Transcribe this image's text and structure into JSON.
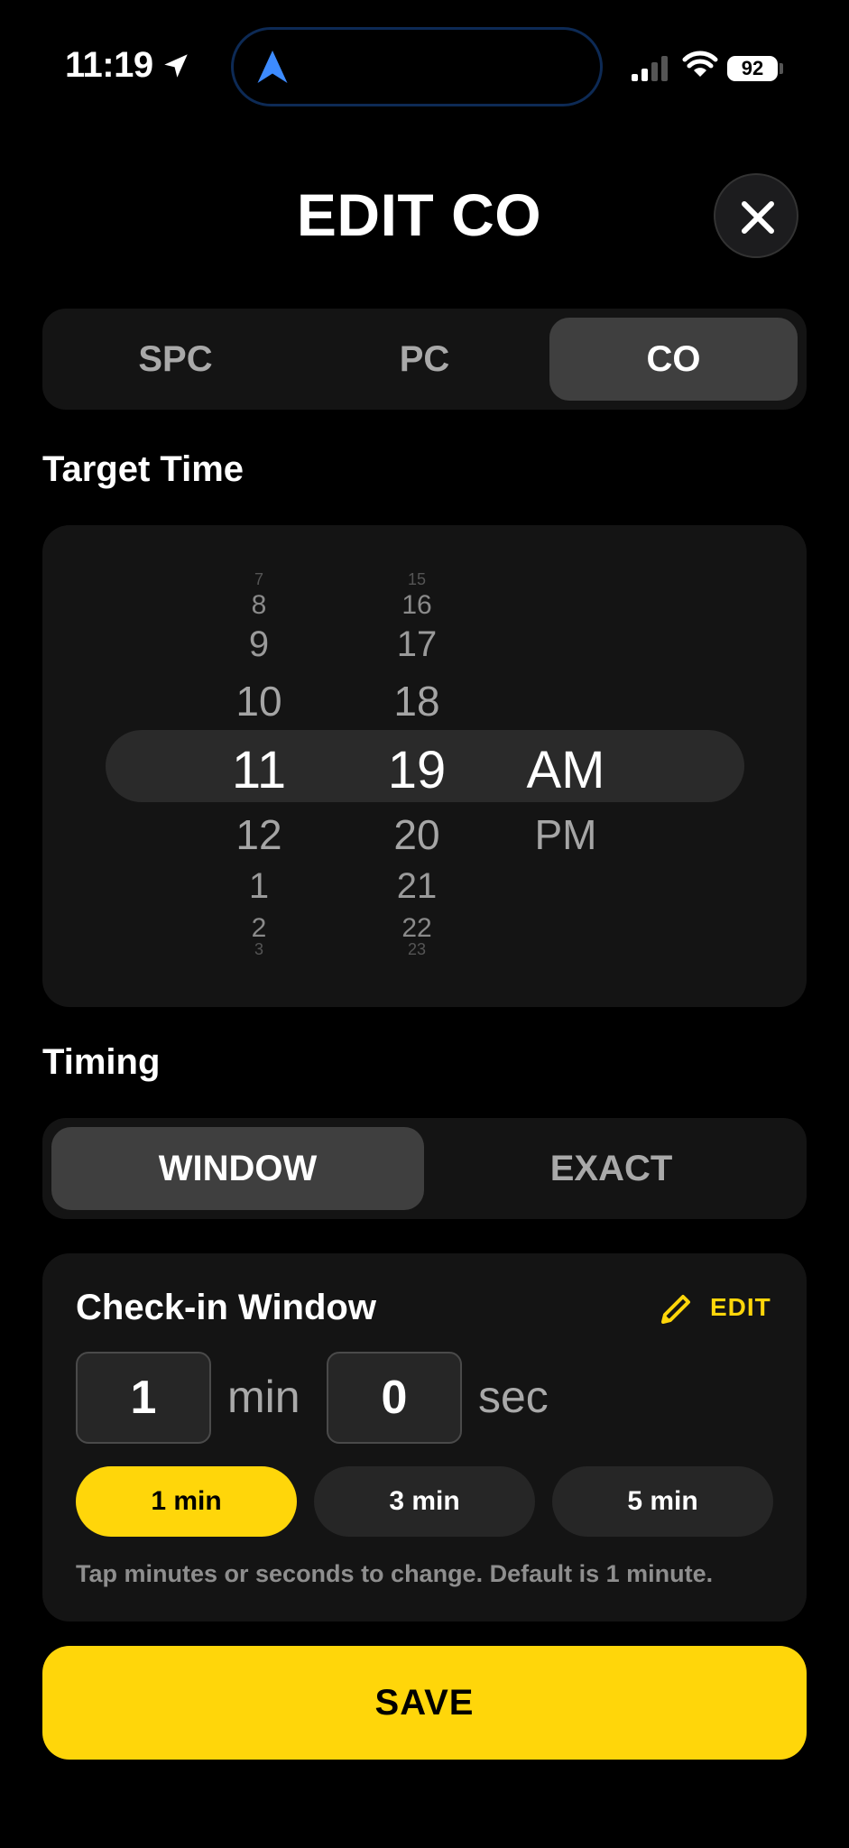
{
  "status_bar": {
    "time": "11:19",
    "battery": "92"
  },
  "header": {
    "title": "EDIT CO"
  },
  "mode_tabs": [
    {
      "label": "SPC",
      "active": false
    },
    {
      "label": "PC",
      "active": false
    },
    {
      "label": "CO",
      "active": true
    }
  ],
  "target_time": {
    "label": "Target Time",
    "hours": [
      "7",
      "8",
      "9",
      "10",
      "11",
      "12",
      "1",
      "2",
      "3"
    ],
    "minutes": [
      "15",
      "16",
      "17",
      "18",
      "19",
      "20",
      "21",
      "22",
      "23"
    ],
    "periods": [
      "AM",
      "PM"
    ],
    "selected": {
      "hour": "11",
      "minute": "19",
      "period": "AM"
    }
  },
  "timing": {
    "label": "Timing",
    "options": [
      {
        "label": "WINDOW",
        "active": true
      },
      {
        "label": "EXACT",
        "active": false
      }
    ]
  },
  "checkin": {
    "title": "Check-in Window",
    "edit_label": "EDIT",
    "minutes_value": "1",
    "minutes_unit": "min",
    "seconds_value": "0",
    "seconds_unit": "sec",
    "presets": [
      {
        "label": "1 min",
        "active": true
      },
      {
        "label": "3 min",
        "active": false
      },
      {
        "label": "5 min",
        "active": false
      }
    ],
    "hint": "Tap minutes or seconds to change. Default is 1 minute."
  },
  "save_label": "SAVE",
  "colors": {
    "accent": "#ffd60a",
    "background": "#000000",
    "card": "#141414",
    "active_segment": "#3f3f3f"
  }
}
